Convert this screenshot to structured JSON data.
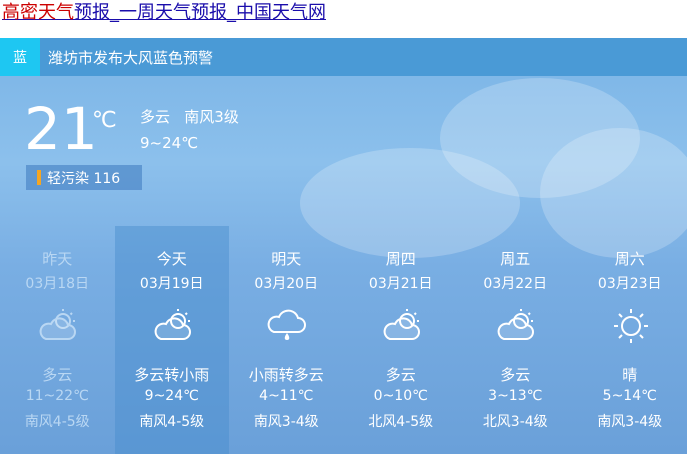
{
  "header": {
    "title_red": "高密天气",
    "title_rest": "预报_一周天气预报_中国天气网"
  },
  "alert": {
    "badge": "蓝",
    "text": "潍坊市发布大风蓝色预警"
  },
  "current": {
    "temp": "21",
    "unit": "℃",
    "condition": "多云   南风3级",
    "range": "9~24℃",
    "aqi": "轻污染 116"
  },
  "forecast": [
    {
      "name": "昨天",
      "date": "03月18日",
      "icon": "cloudy-icon",
      "condition": "多云",
      "temp": "11~22℃",
      "wind": "南风4-5级"
    },
    {
      "name": "今天",
      "date": "03月19日",
      "icon": "cloudy-icon",
      "condition": "多云转小雨",
      "temp": "9~24℃",
      "wind": "南风4-5级"
    },
    {
      "name": "明天",
      "date": "03月20日",
      "icon": "rain-icon",
      "condition": "小雨转多云",
      "temp": "4~11℃",
      "wind": "南风3-4级"
    },
    {
      "name": "周四",
      "date": "03月21日",
      "icon": "cloudy-icon",
      "condition": "多云",
      "temp": "0~10℃",
      "wind": "北风4-5级"
    },
    {
      "name": "周五",
      "date": "03月22日",
      "icon": "cloudy-icon",
      "condition": "多云",
      "temp": "3~13℃",
      "wind": "北风3-4级"
    },
    {
      "name": "周六",
      "date": "03月23日",
      "icon": "sunny-icon",
      "condition": "晴",
      "temp": "5~14℃",
      "wind": "南风3-4级"
    }
  ]
}
